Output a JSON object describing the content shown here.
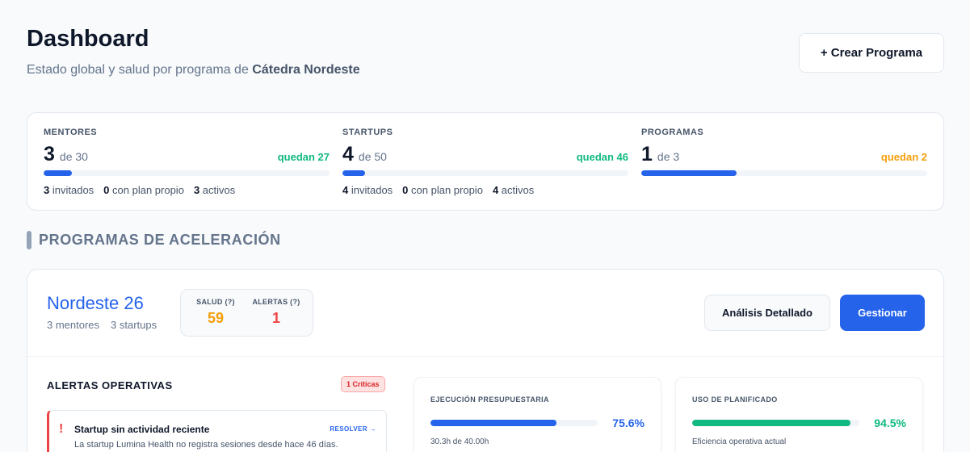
{
  "header": {
    "title": "Dashboard",
    "subtitle_prefix": "Estado global y salud por programa de ",
    "org_name": "Cátedra Nordeste",
    "create_button": "+ Crear Programa"
  },
  "stats": [
    {
      "label": "MENTORES",
      "value": "3",
      "of_text": "de 30",
      "remaining_text": "quedan 27",
      "remaining_color": "#10b981",
      "fill_fraction": 0.1,
      "details": [
        {
          "count": "3",
          "label": "invitados"
        },
        {
          "count": "0",
          "label": "con plan propio"
        },
        {
          "count": "3",
          "label": "activos"
        }
      ]
    },
    {
      "label": "STARTUPS",
      "value": "4",
      "of_text": "de 50",
      "remaining_text": "quedan 46",
      "remaining_color": "#10b981",
      "fill_fraction": 0.08,
      "details": [
        {
          "count": "4",
          "label": "invitados"
        },
        {
          "count": "0",
          "label": "con plan propio"
        },
        {
          "count": "4",
          "label": "activos"
        }
      ]
    },
    {
      "label": "PROGRAMAS",
      "value": "1",
      "of_text": "de 3",
      "remaining_text": "quedan 2",
      "remaining_color": "#f59e0b",
      "fill_fraction": 0.333,
      "details": []
    }
  ],
  "section": {
    "title": "PROGRAMAS DE ACELERACIÓN"
  },
  "program": {
    "name": "Nordeste 26",
    "mentors": "3 mentores",
    "startups": "3 startups",
    "health_label": "SALUD (?)",
    "health_value": "59",
    "health_color": "#f59e0b",
    "alerts_label": "ALERTAS (?)",
    "alerts_value": "1",
    "alerts_color": "#ef4444",
    "analysis_button": "Análisis Detallado",
    "manage_button": "Gestionar",
    "alerts": {
      "title": "ALERTAS OPERATIVAS",
      "critical_badge": "1 Críticas",
      "items": [
        {
          "icon": "!",
          "title": "Startup sin actividad reciente",
          "action": "RESOLVER →",
          "description": "La startup Lumina Health no registra sesiones desde hace 46 días."
        }
      ]
    },
    "kpis": [
      {
        "label": "EJECUCIÓN PRESUPUESTARIA",
        "value": "75.6%",
        "fill_fraction": 0.756,
        "color": "#2563eb",
        "value_color": "#2563eb",
        "sub": "30.3h de 40.00h"
      },
      {
        "label": "USO DE PLANIFICADO",
        "value": "94.5%",
        "fill_fraction": 0.945,
        "color": "#10b981",
        "value_color": "#10b981",
        "sub": "Eficiencia operativa actual"
      }
    ]
  }
}
